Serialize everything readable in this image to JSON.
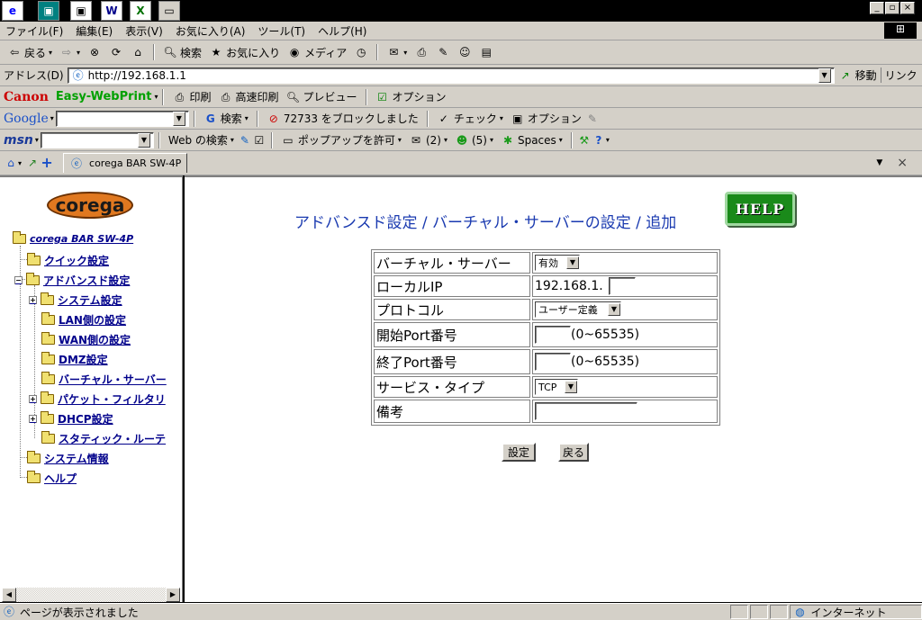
{
  "taskbar": {
    "icons": [
      "e",
      "▣",
      "▣",
      "W",
      "X",
      "▭"
    ]
  },
  "menubar": {
    "items": [
      "ファイル(F)",
      "編集(E)",
      "表示(V)",
      "お気に入り(A)",
      "ツール(T)",
      "ヘルプ(H)"
    ]
  },
  "toolbar": {
    "back": "戻る",
    "search": "検索",
    "favorites": "お気に入り",
    "media": "メディア"
  },
  "address": {
    "label": "アドレス(D)",
    "url": "http://192.168.1.1",
    "go": "移動",
    "links": "リンク"
  },
  "canon": {
    "brand": "Canon",
    "product": "Easy-WebPrint",
    "print": "印刷",
    "fast_print": "高速印刷",
    "preview": "プレビュー",
    "options": "オプション"
  },
  "google": {
    "logo": "Google",
    "search": "検索",
    "blocked": "72733 をブロックしました",
    "check": "チェック",
    "options": "オプション"
  },
  "msn": {
    "logo": "msn",
    "web_search": "Web の検索",
    "popup": "ポップアップを許可",
    "mail": "(2)",
    "buddies": "(5)",
    "spaces": "Spaces"
  },
  "tabs": {
    "active": "corega BAR SW-4P"
  },
  "sidebar": {
    "logo": "corega",
    "root": "corega BAR SW-4P",
    "items": [
      "クイック設定",
      "アドバンスド設定",
      "システム設定",
      "LAN側の設定",
      "WAN側の設定",
      "DMZ設定",
      "バーチャル・サーバー",
      "パケット・フィルタリ",
      "DHCP設定",
      "スタティック・ルーテ",
      "システム情報",
      "ヘルプ"
    ]
  },
  "main": {
    "breadcrumb": "アドバンスド設定 / バーチャル・サーバーの設定 / 追加",
    "help": "HELP",
    "rows": [
      {
        "label": "バーチャル・サーバー",
        "value": "有効"
      },
      {
        "label": "ローカルIP",
        "value": "192.168.1."
      },
      {
        "label": "プロトコル",
        "value": "ユーザー定義"
      },
      {
        "label": "開始Port番号",
        "value": "(0~65535)"
      },
      {
        "label": "終了Port番号",
        "value": "(0~65535)"
      },
      {
        "label": "サービス・タイプ",
        "value": "TCP"
      },
      {
        "label": "備考",
        "value": ""
      }
    ],
    "submit": "設定",
    "back": "戻る"
  },
  "status": {
    "text": "ページが表示されました",
    "zone": "インターネット"
  }
}
